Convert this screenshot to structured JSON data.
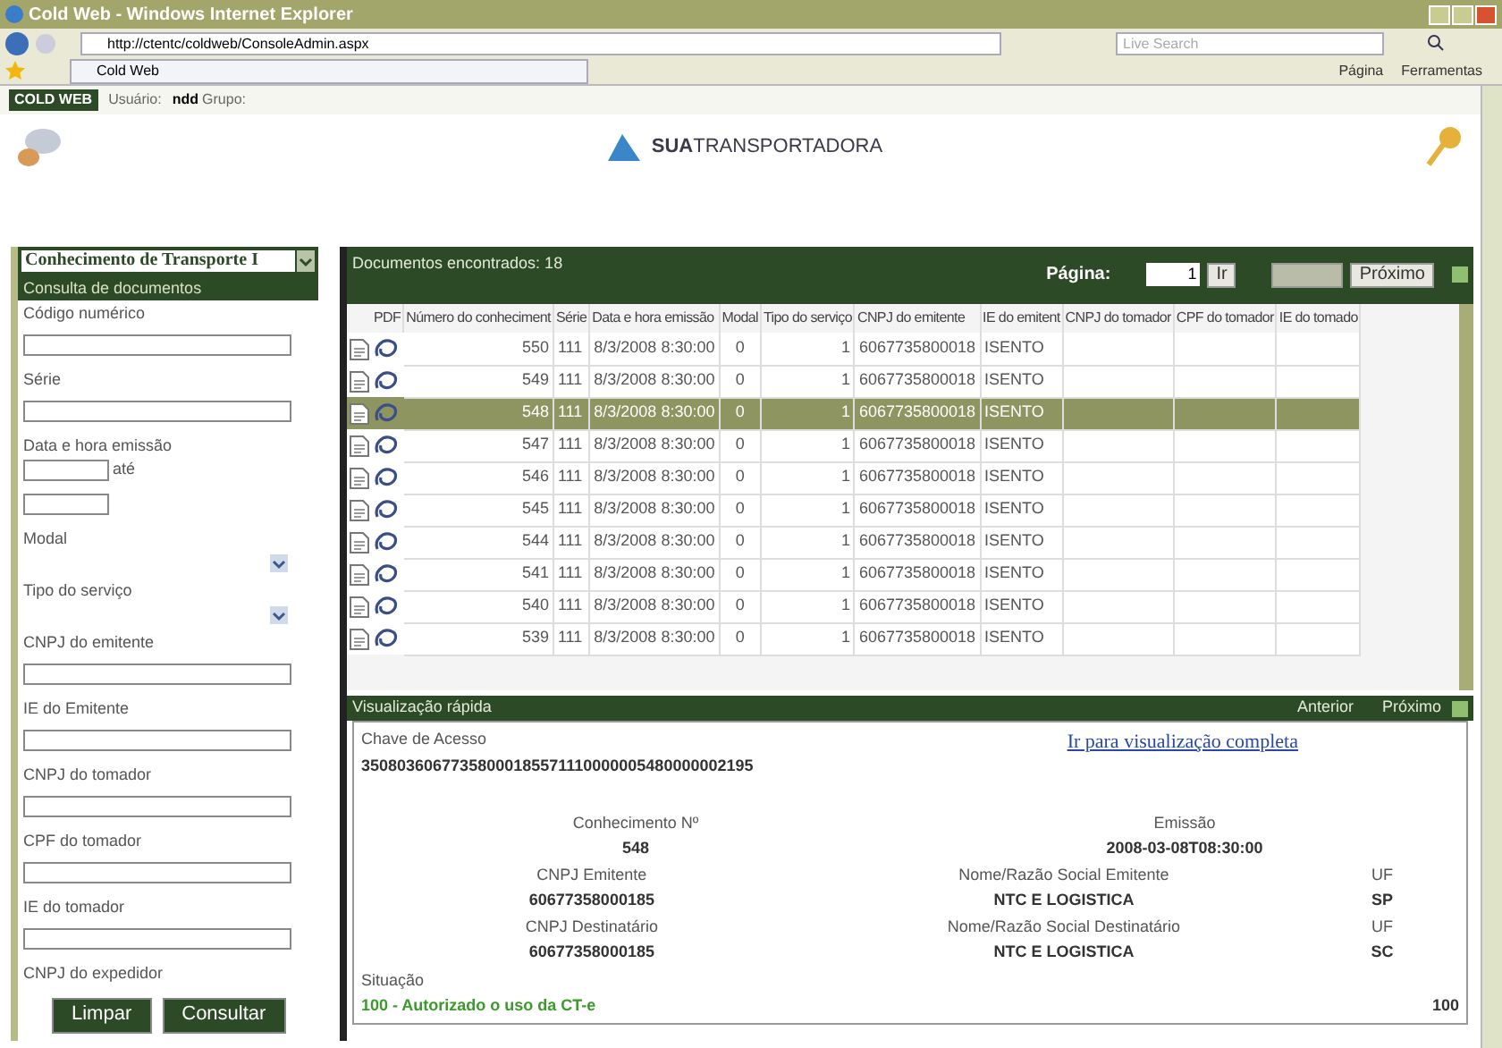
{
  "browser": {
    "title": "Cold Web - Windows Internet Explorer",
    "url": "http://ctentc/coldweb/ConsoleAdmin.aspx",
    "search_placeholder": "Live Search",
    "tab": "Cold Web",
    "menu": [
      "Página",
      "Ferramentas"
    ]
  },
  "header": {
    "logo": "COLD WEB",
    "user_label": "Usuário:",
    "user": "ndd",
    "group_label": "Grupo:",
    "brand": "**SUA**TRANSPORTADORA"
  },
  "sidebar": {
    "dropdown": "Conhecimento de Transporte I",
    "section": "Consulta de documentos",
    "fields": [
      {
        "kind": "text",
        "label": "Código numérico"
      },
      {
        "kind": "text",
        "label": "Série"
      },
      {
        "kind": "daterange",
        "label": "Data e hora emissão",
        "between": "até"
      },
      {
        "kind": "select",
        "label": "Modal"
      },
      {
        "kind": "select",
        "label": "Tipo do serviço"
      },
      {
        "kind": "text",
        "label": "CNPJ do emitente"
      },
      {
        "kind": "text",
        "label": "IE do Emitente"
      },
      {
        "kind": "text",
        "label": "CNPJ do tomador"
      },
      {
        "kind": "text",
        "label": "CPF do tomador"
      },
      {
        "kind": "text",
        "label": "IE do tomador"
      },
      {
        "kind": "label",
        "label": "CNPJ do expedidor"
      }
    ],
    "buttons": [
      "Limpar",
      "Consultar"
    ]
  },
  "results": {
    "count_text": "Documentos encontrados: 18",
    "page_label": "Página:",
    "page_value": "1",
    "go_button": "Ir",
    "prev_button": {
      "disabled": true
    },
    "next_button": "Próximo",
    "columns": [
      "PDF",
      "Número do conheciment",
      "Série",
      "Data e hora emissão",
      "Modal",
      "Tipo do serviço",
      "CNPJ do emitente",
      "IE do emitent",
      "CNPJ do tomador",
      "CPF do tomador",
      "IE do tomado"
    ],
    "rows": [
      {
        "selected": false,
        "number": "550",
        "serie": "111",
        "date": "8/3/2008 8:30:00",
        "modal": "0",
        "service": "1",
        "cnpj": "6067735800018",
        "ie": "ISENTO"
      },
      {
        "selected": false,
        "number": "549",
        "serie": "111",
        "date": "8/3/2008 8:30:00",
        "modal": "0",
        "service": "1",
        "cnpj": "6067735800018",
        "ie": "ISENTO"
      },
      {
        "selected": true,
        "number": "548",
        "serie": "111",
        "date": "8/3/2008 8:30:00",
        "modal": "0",
        "service": "1",
        "cnpj": "6067735800018",
        "ie": "ISENTO"
      },
      {
        "selected": false,
        "number": "547",
        "serie": "111",
        "date": "8/3/2008 8:30:00",
        "modal": "0",
        "service": "1",
        "cnpj": "6067735800018",
        "ie": "ISENTO"
      },
      {
        "selected": false,
        "number": "546",
        "serie": "111",
        "date": "8/3/2008 8:30:00",
        "modal": "0",
        "service": "1",
        "cnpj": "6067735800018",
        "ie": "ISENTO"
      },
      {
        "selected": false,
        "number": "545",
        "serie": "111",
        "date": "8/3/2008 8:30:00",
        "modal": "0",
        "service": "1",
        "cnpj": "6067735800018",
        "ie": "ISENTO"
      },
      {
        "selected": false,
        "number": "544",
        "serie": "111",
        "date": "8/3/2008 8:30:00",
        "modal": "0",
        "service": "1",
        "cnpj": "6067735800018",
        "ie": "ISENTO"
      },
      {
        "selected": false,
        "number": "541",
        "serie": "111",
        "date": "8/3/2008 8:30:00",
        "modal": "0",
        "service": "1",
        "cnpj": "6067735800018",
        "ie": "ISENTO"
      },
      {
        "selected": false,
        "number": "540",
        "serie": "111",
        "date": "8/3/2008 8:30:00",
        "modal": "0",
        "service": "1",
        "cnpj": "6067735800018",
        "ie": "ISENTO"
      },
      {
        "selected": false,
        "number": "539",
        "serie": "111",
        "date": "8/3/2008 8:30:00",
        "modal": "0",
        "service": "1",
        "cnpj": "6067735800018",
        "ie": "ISENTO"
      }
    ]
  },
  "quick_view": {
    "title": "Visualização rápida",
    "prev": "Anterior",
    "next": "Próximo",
    "access_key_label": "Chave de Acesso",
    "access_key": "35080360677358000185571110000005480000002195",
    "full_view_link": "Ir para visualização completa",
    "detail_rows": [
      [
        {
          "label": "Conhecimento Nº",
          "value": "548"
        },
        {
          "label": "Emissão",
          "value": "2008-03-08T08:30:00"
        }
      ],
      [
        {
          "label": "CNPJ Emitente",
          "value": "60677358000185"
        },
        {
          "label": "Nome/Razão Social Emitente",
          "value": "NTC E LOGISTICA"
        },
        {
          "label": "UF",
          "value": "SP"
        }
      ],
      [
        {
          "label": "CNPJ Destinatário",
          "value": "60677358000185"
        },
        {
          "label": "Nome/Razão Social Destinatário",
          "value": "NTC E LOGISTICA"
        },
        {
          "label": "UF",
          "value": "SC"
        }
      ]
    ],
    "status": {
      "label": "Situação",
      "value": "100 - Autorizado o uso da CT-e",
      "code": "100"
    }
  }
}
